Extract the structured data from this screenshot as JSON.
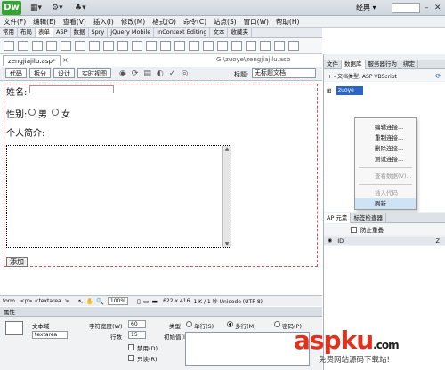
{
  "app": {
    "logo": "Dw",
    "layout_label": "经典 ▾"
  },
  "menu": [
    "文件(F)",
    "编辑(E)",
    "查看(V)",
    "插入(I)",
    "修改(M)",
    "格式(O)",
    "命令(C)",
    "站点(S)",
    "窗口(W)",
    "帮助(H)"
  ],
  "insert_tabs": [
    "常用",
    "布局",
    "表单",
    "ASP",
    "数据",
    "Spry",
    "jQuery Mobile",
    "InContext Editing",
    "文本",
    "收藏夹"
  ],
  "insert_active": "表单",
  "document": {
    "tab": "zengjiajilu.asp*",
    "path": "G:\\zuoye\\zengjiajilu.asp",
    "view_buttons": [
      "代码",
      "拆分",
      "设计",
      "实时视图"
    ],
    "title_label": "标题:",
    "title_value": "无标题文档"
  },
  "form": {
    "name_label": "姓名:",
    "gender_label": "性别:",
    "male": "男",
    "female": "女",
    "intro_label": "个人简介:",
    "add_button": "添加"
  },
  "status": {
    "tagpath": "form.. <p> <textarea..>",
    "zoom": "100%",
    "size": "622 x 416",
    "info": "1 K / 1 秒 Unicode (UTF-8)"
  },
  "properties": {
    "header": "属性",
    "type_label": "文本域",
    "name_value": "textarea",
    "width_label": "字符宽度(W)",
    "width_value": "60",
    "rows_label": "行数",
    "rows_value": "15",
    "init_label": "初始值(I)",
    "kind_label": "类型",
    "single": "单行(S)",
    "multi": "多行(M)",
    "password": "密码(P)",
    "disabled": "禁用(D)",
    "readonly": "只读(R)"
  },
  "right_panel": {
    "tabs": [
      "文件",
      "数据库",
      "服务器行为",
      "绑定"
    ],
    "doc_type": "+ - 文档类型: ASP VBScript",
    "tree_item": "zuoye",
    "context_menu": [
      {
        "label": "编辑连接...",
        "disabled": false
      },
      {
        "label": "重制连接...",
        "disabled": false
      },
      {
        "label": "删除连接...",
        "disabled": false
      },
      {
        "label": "测试连接...",
        "disabled": false
      },
      {
        "label": "查看数据(V)...",
        "disabled": true
      },
      {
        "label": "插入代码",
        "disabled": true
      },
      {
        "label": "刷新",
        "disabled": false
      }
    ],
    "ap_tabs": [
      "AP 元素",
      "标签检查器"
    ],
    "ap_checkbox": "防止重叠",
    "ap_col_id": "ID",
    "ap_col_z": "Z"
  },
  "watermark": {
    "main": "aspku",
    "dot": ".com",
    "sub": "免费网站源码下载站!"
  }
}
